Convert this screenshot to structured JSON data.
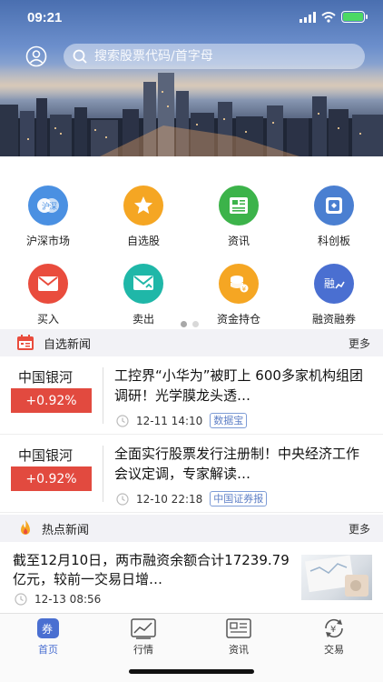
{
  "status_bar": {
    "time": "09:21"
  },
  "search": {
    "placeholder": "搜索股票代码/首字母"
  },
  "grid": [
    {
      "label": "沪深市场",
      "icon": "shanghai-shenzhen-market-icon",
      "color": "#4a90e2"
    },
    {
      "label": "自选股",
      "icon": "star-icon",
      "color": "#f5a623"
    },
    {
      "label": "资讯",
      "icon": "news-icon",
      "color": "#3cb34a"
    },
    {
      "label": "科创板",
      "icon": "star-market-icon",
      "color": "#4a7fd1"
    },
    {
      "label": "买入",
      "icon": "buy-icon",
      "color": "#e94c3d"
    },
    {
      "label": "卖出",
      "icon": "sell-icon",
      "color": "#1fb7a8"
    },
    {
      "label": "资金持仓",
      "icon": "funds-holdings-icon",
      "color": "#f5a623"
    },
    {
      "label": "融资融券",
      "icon": "margin-trading-icon",
      "color": "#4a6fd1"
    }
  ],
  "watchlist_news": {
    "title": "自选新闻",
    "more": "更多",
    "items": [
      {
        "stock": "中国银河",
        "change": "+0.92%",
        "title": "工控界“小华为”被盯上 600多家机构组团调研！光学膜龙头透…",
        "time": "12-11 14:10",
        "source": "数据宝"
      },
      {
        "stock": "中国银河",
        "change": "+0.92%",
        "title": "全面实行股票发行注册制！中央经济工作会议定调，专家解读…",
        "time": "12-10 22:18",
        "source": "中国证券报"
      }
    ]
  },
  "hot_news": {
    "title": "热点新闻",
    "more": "更多",
    "items": [
      {
        "title": "截至12月10日，两市融资余额合计17239.79亿元，较前一交易日增…",
        "time": "12-13 08:56"
      }
    ]
  },
  "tabbar": [
    {
      "label": "首页",
      "icon": "home-icon",
      "active": true
    },
    {
      "label": "行情",
      "icon": "market-chart-icon",
      "active": false
    },
    {
      "label": "资讯",
      "icon": "news-tab-icon",
      "active": false
    },
    {
      "label": "交易",
      "icon": "trade-icon",
      "active": false
    }
  ],
  "colors": {
    "accent": "#4a6fd1",
    "up": "#e24a3f",
    "source_tag": "#5e7fc6"
  }
}
